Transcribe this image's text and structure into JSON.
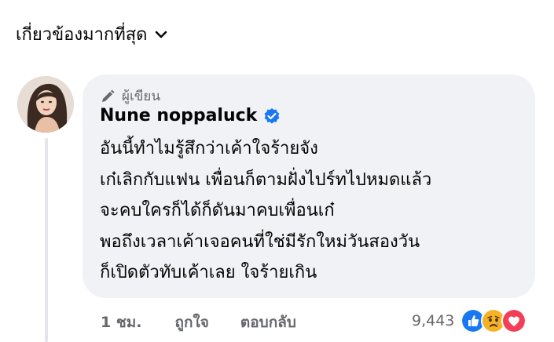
{
  "sort": {
    "label": "เกี่ยวข้องมากที่สุด",
    "icon": "chevron-down-icon"
  },
  "comment": {
    "author_badge": "ผู้เขียน",
    "author_name": "Nune noppaluck",
    "verified_icon": "verified-badge-icon",
    "lines": [
      "อันนี้ทำไมรู้สึกว่าเค้าใจร้ายจัง",
      "เก๋เลิกกับแฟน เพื่อนก็ตามฝั่งไปร์ทไปหมดแล้ว",
      "จะคบใครก็ได้ก็ดันมาคบเพื่อนเก๋",
      "พอถึงเวลาเค้าเจอคนที่ใช่มีรักใหม่วันสองวัน",
      "ก็เปิดตัวทับเค้าเลย ใจร้ายเกิน"
    ],
    "timestamp": "1 ชม.",
    "like_label": "ถูกใจ",
    "reply_label": "ตอบกลับ",
    "reaction_count": "9,443",
    "reactions": [
      "like-icon",
      "sad-icon",
      "love-icon"
    ]
  },
  "colors": {
    "bubble": "#f0f2f5",
    "secondary_text": "#65676b",
    "like_blue": "#1877f2",
    "love_red": "#f33e58",
    "sad_yellow": "#f7b125"
  }
}
